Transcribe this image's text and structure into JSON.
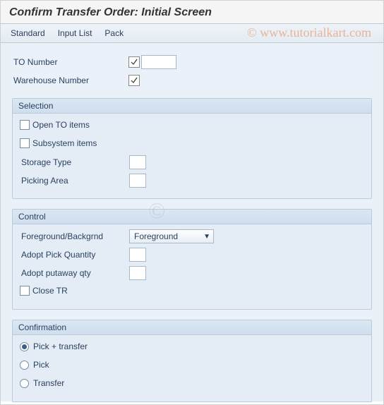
{
  "title": "Confirm Transfer Order: Initial Screen",
  "menu": {
    "standard": "Standard",
    "input_list": "Input List",
    "pack": "Pack"
  },
  "header_fields": {
    "to_number": {
      "label": "TO Number",
      "value": ""
    },
    "warehouse_number": {
      "label": "Warehouse Number",
      "value": ""
    }
  },
  "selection": {
    "title": "Selection",
    "open_to_items": {
      "label": "Open TO items",
      "checked": false
    },
    "subsystem_items": {
      "label": "Subsystem items",
      "checked": false
    },
    "storage_type": {
      "label": "Storage Type",
      "value": ""
    },
    "picking_area": {
      "label": "Picking Area",
      "value": ""
    }
  },
  "control": {
    "title": "Control",
    "foreground_background": {
      "label": "Foreground/Backgrnd",
      "value": "Foreground"
    },
    "adopt_pick_quantity": {
      "label": "Adopt Pick Quantity",
      "value": ""
    },
    "adopt_putaway_qty": {
      "label": "Adopt putaway qty",
      "value": ""
    },
    "close_tr": {
      "label": "Close TR",
      "checked": false
    }
  },
  "confirmation": {
    "title": "Confirmation",
    "selected": "pick_transfer",
    "pick_transfer": {
      "label": "Pick + transfer"
    },
    "pick": {
      "label": "Pick"
    },
    "transfer": {
      "label": "Transfer"
    }
  },
  "watermark": "© www.tutorialkart.com",
  "watermark_c": "©"
}
